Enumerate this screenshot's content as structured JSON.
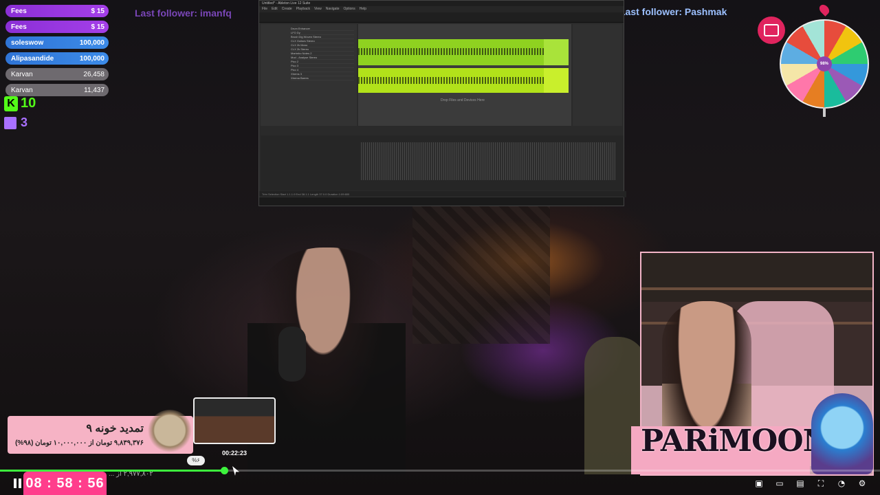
{
  "donations": [
    {
      "name": "Fees",
      "amount": "$ 15",
      "style": "purple"
    },
    {
      "name": "Fees",
      "amount": "$ 15",
      "style": "purple"
    },
    {
      "name": "soleswow",
      "amount": "100,000",
      "style": "blue"
    },
    {
      "name": "Alipasandide",
      "amount": "100,000",
      "style": "blue"
    },
    {
      "name": "Karvan",
      "amount": "26,458",
      "style": "gray"
    },
    {
      "name": "Karvan",
      "amount": "11,437",
      "style": "gray"
    }
  ],
  "kick": {
    "logo": "K",
    "count": "10"
  },
  "twitch": {
    "count": "3"
  },
  "followers": {
    "left": "Last follower: imanfq",
    "right": "Last follower: Pashmak"
  },
  "daw": {
    "title": "Untitled* - Ableton Live 12 Suite",
    "menu": [
      "File",
      "Edit",
      "Create",
      "Playback",
      "View",
      "Navigate",
      "Options",
      "Help"
    ],
    "browser_items": [
      "Drum Enhancer",
      "LFO Dy",
      "Brush Dig Woven Stereo",
      "CLX Guitars Stereo",
      "CLX 2k Mono",
      "CLX 2k Stereo",
      "Marimbo Notes 2",
      "Mod - Analyse Stereo",
      "Pico 2",
      "Pico 3",
      "Pico 4",
      "Xtrems 3",
      "Xtrema Barres"
    ],
    "drop_hint": "Drop Files and Devices Here",
    "statusbar": "Trim Selection  Start 1.1.1.0  End 38.1.1  Length 37.0.0  Duration 1:09:800"
  },
  "wheel": {
    "center_label": "98%"
  },
  "streamer_brand": "PARiMOON",
  "subscription": {
    "title": "تمدید خونه ۹",
    "amount": "۹,۸۳۹,۳۷۶ تومان از ۱۰,۰۰۰,۰۰۰ تومان (۹۸%)"
  },
  "seek_preview": {
    "time": "00:22:23",
    "badge": "%۶"
  },
  "faint_text": "۲,۹۷۷,۸۰۲ از ...",
  "player": {
    "timer": "08 : 58 : 56",
    "progress_fraction": 0.255,
    "controls": [
      "pip-icon",
      "theater-icon",
      "chat-icon",
      "fullscreen-icon",
      "speed-icon",
      "settings-icon"
    ]
  },
  "colors": {
    "accent_green": "#3df33d",
    "timer_pink": "#ff3e8c",
    "kick_green": "#53fc18",
    "twitch_purple": "#a970ff"
  }
}
